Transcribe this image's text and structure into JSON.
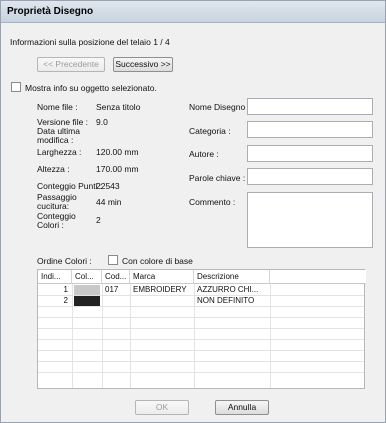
{
  "window": {
    "title": "Proprietà Disegno"
  },
  "nav": {
    "info_label": "Informazioni sulla posizione del telaio",
    "position": "1 / 4",
    "prev_label": "<< Precedente",
    "next_label": "Successivo >>",
    "show_selected_label": "Mostra info su oggetto selezionato."
  },
  "info": {
    "file_name_label": "Nome file :",
    "file_name_value": "Senza titolo",
    "version_label": "Versione file :",
    "version_value": "9.0",
    "date_label_1": "Data ultima",
    "date_label_2": "modifica :",
    "width_label": "Larghezza :",
    "width_value": "120.00 mm",
    "height_label": "Altezza :",
    "height_value": "170.00 mm",
    "points_label": "Conteggio Punti :",
    "points_value": "22543",
    "pass_label_1": "Passaggio",
    "pass_label_2": "cucitura:",
    "pass_value": "44 min",
    "colors_label_1": "Conteggio",
    "colors_label_2": "Colori :",
    "colors_value": "2"
  },
  "meta": {
    "design_name_label": "Nome Disegno :",
    "category_label": "Categoria :",
    "author_label": "Autore :",
    "keywords_label": "Parole chiave :",
    "comment_label": "Commento :"
  },
  "colors": {
    "order_label": "Ordine Colori :",
    "base_color_label": "Con colore di base",
    "columns": [
      "Indi...",
      "Col...",
      "Cod...",
      "Marca",
      "Descrizione"
    ],
    "rows": [
      {
        "index": "1",
        "swatch": "#c8c8c8",
        "code": "017",
        "brand": "EMBROIDERY",
        "description": "AZZURRO CHI..."
      },
      {
        "index": "2",
        "swatch": "#222222",
        "code": "",
        "brand": "",
        "description": "NON DEFINITO"
      }
    ]
  },
  "buttons": {
    "ok_label": "OK",
    "cancel_label": "Annulla"
  }
}
